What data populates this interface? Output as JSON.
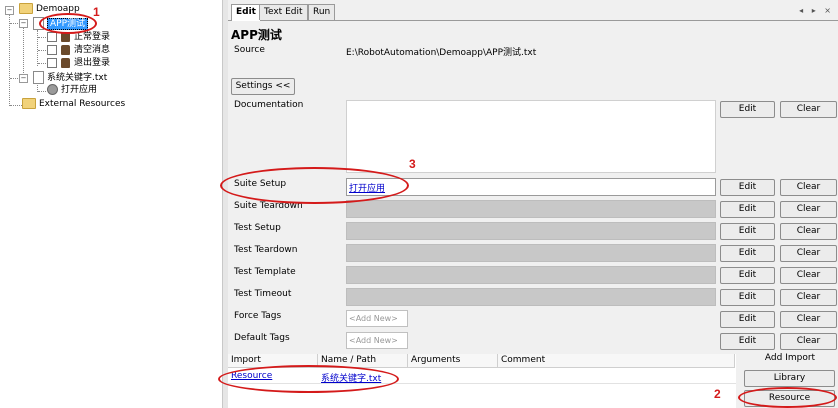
{
  "tree": {
    "root": "Demoapp",
    "suite": "APP测试",
    "tests": [
      "正常登录",
      "清空消息",
      "退出登录"
    ],
    "resource_file": "系统关键字.txt",
    "keyword": "打开应用",
    "external": "External Resources"
  },
  "annotations": {
    "n1": "1",
    "n2": "2",
    "n3": "3"
  },
  "tabs": [
    "Edit",
    "Text Edit",
    "Run"
  ],
  "nav_arrows": "◂ ▸ ×",
  "editor": {
    "title": "APP测试",
    "source_label": "Source",
    "source_value": "E:\\RobotAutomation\\Demoapp\\APP测试.txt",
    "settings_button": "Settings <<",
    "edit_label": "Edit",
    "clear_label": "Clear",
    "rows": [
      {
        "label": "Documentation"
      },
      {
        "label": "Suite Setup",
        "value": "打开应用"
      },
      {
        "label": "Suite Teardown"
      },
      {
        "label": "Test Setup"
      },
      {
        "label": "Test Teardown"
      },
      {
        "label": "Test Template"
      },
      {
        "label": "Test Timeout"
      },
      {
        "label": "Force Tags",
        "placeholder": "<Add New>"
      },
      {
        "label": "Default Tags",
        "placeholder": "<Add New>"
      }
    ]
  },
  "imports": {
    "headers": [
      "Import",
      "Name / Path",
      "Arguments",
      "Comment"
    ],
    "rows": [
      {
        "type": "Resource",
        "path": "系统关键字.txt"
      }
    ],
    "add_import_label": "Add Import",
    "library_button": "Library",
    "resource_button": "Resource"
  },
  "colors": {
    "annotation": "#d41a1a",
    "selection": "#3399ff",
    "link": "#0000cc"
  }
}
